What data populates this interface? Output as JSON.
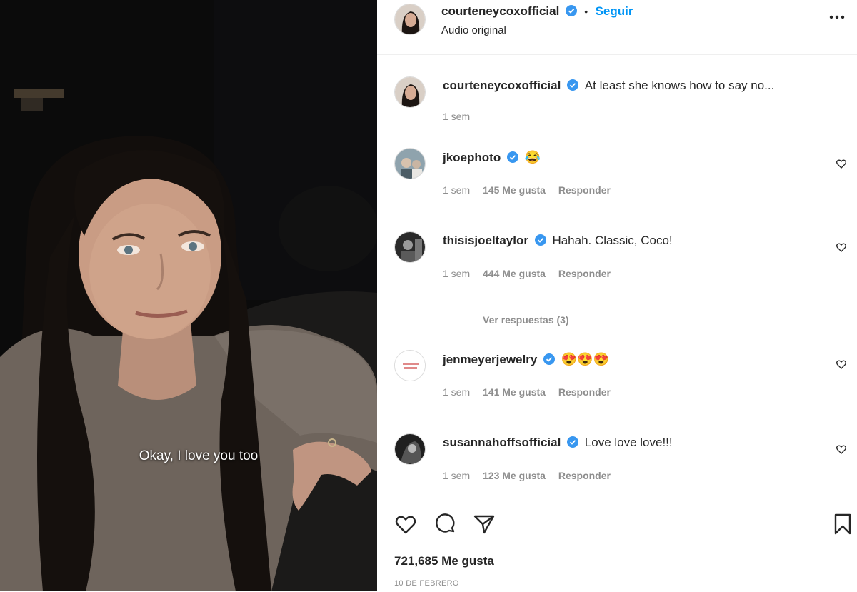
{
  "media": {
    "subtitle": "Okay, I love you too"
  },
  "header": {
    "username": "courteneycoxofficial",
    "separator": "•",
    "follow_label": "Seguir",
    "audio_label": "Audio original",
    "more_icon": "more-options-icon"
  },
  "caption": {
    "username": "courteneycoxofficial",
    "text": "At least she knows how to say no...",
    "time": "1 sem"
  },
  "comments": [
    {
      "username": "jkoephoto",
      "text": "😂",
      "time": "1 sem",
      "likes": "145 Me gusta",
      "reply": "Responder"
    },
    {
      "username": "thisisjoeltaylor",
      "text": "Hahah. Classic, Coco!",
      "time": "1 sem",
      "likes": "444 Me gusta",
      "reply": "Responder"
    },
    {
      "username": "jenmeyerjewelry",
      "text": "😍😍😍",
      "time": "1 sem",
      "likes": "141 Me gusta",
      "reply": "Responder"
    },
    {
      "username": "susannahoffsofficial",
      "text": "Love love love!!!",
      "time": "1 sem",
      "likes": "123 Me gusta",
      "reply": "Responder"
    }
  ],
  "view_replies": "Ver respuestas (3)",
  "footer": {
    "likes_total": "721,685 Me gusta",
    "date": "10 DE FEBRERO"
  },
  "colors": {
    "accent": "#0095f6",
    "text": "#262626",
    "secondary": "#8e8e8e",
    "divider": "#efefef"
  }
}
